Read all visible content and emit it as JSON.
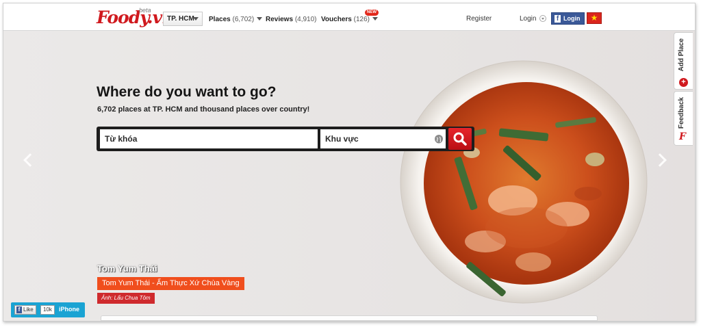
{
  "logo": {
    "text": "Foody.vn",
    "badge": "beta"
  },
  "nav": {
    "city": "TP. HCM",
    "places": {
      "label": "Places",
      "count": "(6,702)"
    },
    "reviews": {
      "label": "Reviews",
      "count": "(4,910)"
    },
    "vouchers": {
      "label": "Vouchers",
      "count": "(126)",
      "badge": "NEW"
    },
    "register": "Register",
    "login": "Login",
    "fb_login": "Login",
    "fb_letter": "f",
    "flag_star": "★"
  },
  "hero": {
    "headline": "Where do you want to go?",
    "subline": "6,702 places at TP. HCM and thousand places over country!",
    "keyword_placeholder": "Từ khóa",
    "area_placeholder": "Khu vực",
    "dish_name": "Tom Yum Thái",
    "restaurant": "Tom Yum Thái - Ẩm Thực Xứ Chùa Vàng",
    "photo_credit": "Ảnh: Lẩu Chua Tôm"
  },
  "side_tabs": {
    "add_place": "Add Place",
    "feedback": "Feedback",
    "plus": "+",
    "f_mark": "F"
  },
  "social": {
    "like": "Like",
    "like_letter": "f",
    "like_count": "10k",
    "iphone": "iPhone"
  },
  "colors": {
    "brand_red": "#d0191e",
    "tag_orange": "#f04e1d",
    "facebook_blue": "#3b5998",
    "social_blue": "#1aa3d3"
  }
}
